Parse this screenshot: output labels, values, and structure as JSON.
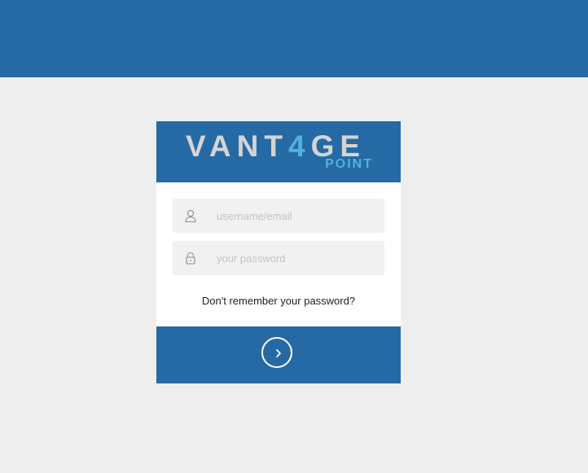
{
  "brand": {
    "word_part1": "VANT",
    "word_accent": "4",
    "word_part2": "GE",
    "sub": "POINT"
  },
  "login": {
    "username_placeholder": "username/email",
    "username_value": "",
    "password_placeholder": "your password",
    "password_value": "",
    "forgot_label": "Don't remember your password?"
  },
  "icons": {
    "username": "user-icon",
    "password": "lock-icon",
    "submit": "chevron-right-icon"
  },
  "colors": {
    "brand_blue": "#256aa5",
    "accent_cyan": "#4fb3dd",
    "background": "#eeeeee",
    "field_bg": "#f1f1f1"
  }
}
